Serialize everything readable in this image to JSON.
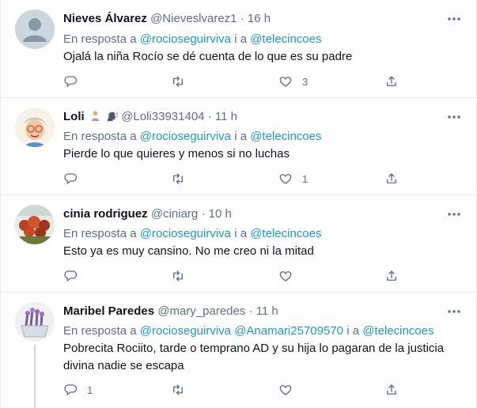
{
  "tweets": [
    {
      "name": "Nieves Álvarez",
      "handle": "@Nieveslvarez1",
      "separator": "·",
      "time": "16 h",
      "reply_prefix": "En resposta a",
      "mentions": [
        "@rocioseguirviva",
        "i a",
        "@telecincoes"
      ],
      "text": "Ojalá la niña Rocío se dé cuenta de lo que es su padre",
      "reply_count": "",
      "retweet_count": "",
      "like_count": "3"
    },
    {
      "name": "Loli",
      "handle": "@Loli33931404",
      "separator": "·",
      "time": "11 h",
      "reply_prefix": "En resposta a",
      "mentions": [
        "@rocioseguirviva",
        "i a",
        "@telecincoes"
      ],
      "text": "Pierde lo que quieres y menos si no luchas",
      "reply_count": "",
      "retweet_count": "",
      "like_count": "1"
    },
    {
      "name": "cinia rodriguez",
      "handle": "@ciniarg",
      "separator": "·",
      "time": "10 h",
      "reply_prefix": "En resposta a",
      "mentions": [
        "@rocioseguirviva",
        "i a",
        "@telecincoes"
      ],
      "text": "Esto ya es muy cansino. No me creo ni la mitad",
      "reply_count": "",
      "retweet_count": "",
      "like_count": ""
    },
    {
      "name": "Maribel Paredes",
      "handle": "@mary_paredes",
      "separator": "·",
      "time": "11 h",
      "reply_prefix": "En resposta a",
      "mentions": [
        "@rocioseguirviva",
        "@Anamari25709570",
        "i a",
        "@telecincoes"
      ],
      "text_line1": "Pobrecita Rociito, tarde o temprano AD y su hija lo pagaran de la justicia",
      "text_line2": "divina nadie se escapa",
      "reply_count": "1",
      "retweet_count": "",
      "like_count": ""
    }
  ],
  "colors": {
    "accent": "#1b95e0",
    "muted": "#5b7083",
    "text": "#0f1419",
    "divider": "#e6ecf0"
  },
  "icons": [
    "reply-icon",
    "retweet-icon",
    "like-icon",
    "share-icon",
    "more-icon",
    "default-avatar-icon"
  ]
}
